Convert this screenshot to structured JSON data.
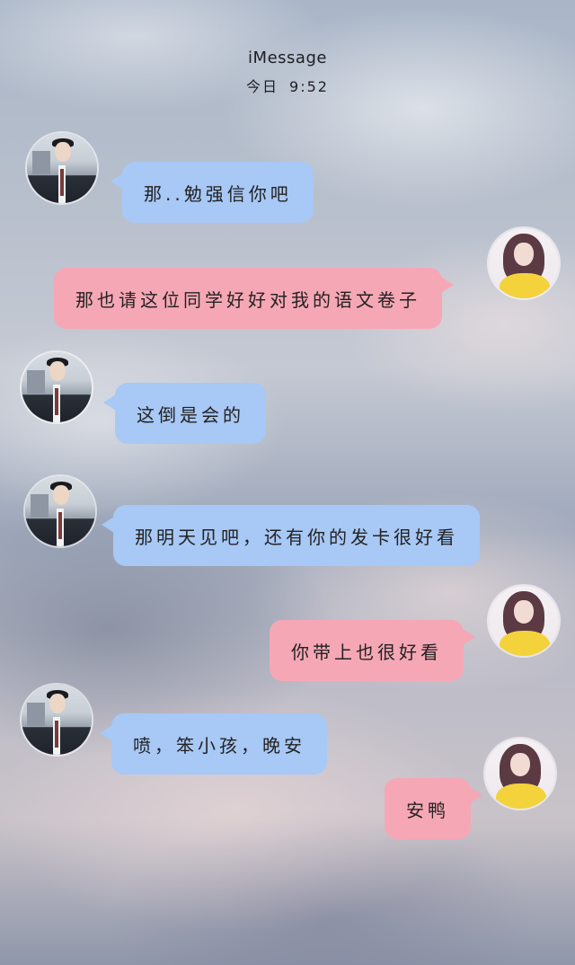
{
  "header": {
    "title": "iMessage",
    "day": "今日",
    "time": "9:52"
  },
  "messages": [
    {
      "from": "other",
      "text": "那..勉强信你吧"
    },
    {
      "from": "me",
      "text": "那也请这位同学好好对我的语文卷子"
    },
    {
      "from": "other",
      "text": "这倒是会的"
    },
    {
      "from": "other",
      "text": "那明天见吧，还有你的发卡很好看"
    },
    {
      "from": "me",
      "text": "你带上也很好看"
    },
    {
      "from": "other",
      "text": "喷，笨小孩，晚安"
    },
    {
      "from": "me",
      "text": "安鸭"
    }
  ],
  "colors": {
    "incoming_bubble": "#a8c8f5",
    "outgoing_bubble": "#f6a7b5"
  }
}
